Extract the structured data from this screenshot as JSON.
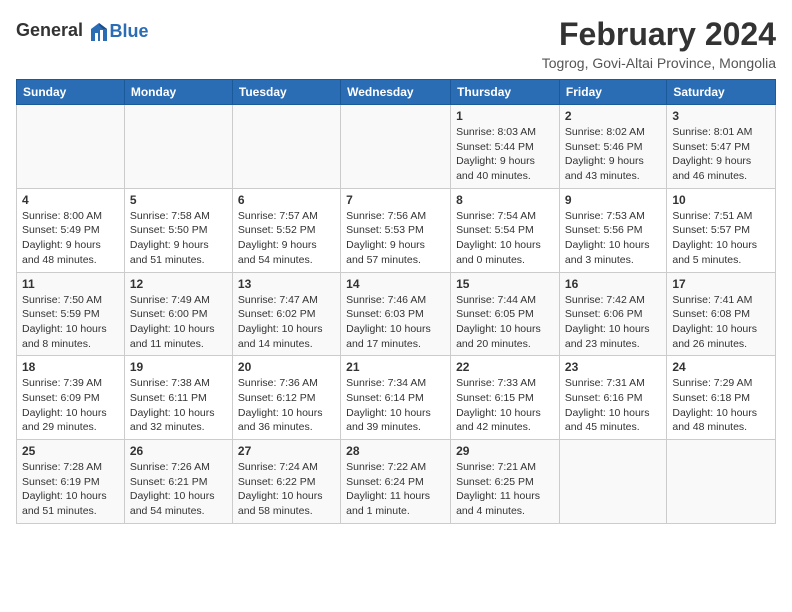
{
  "header": {
    "logo_general": "General",
    "logo_blue": "Blue",
    "title": "February 2024",
    "subtitle": "Togrog, Govi-Altai Province, Mongolia"
  },
  "weekdays": [
    "Sunday",
    "Monday",
    "Tuesday",
    "Wednesday",
    "Thursday",
    "Friday",
    "Saturday"
  ],
  "weeks": [
    [
      {
        "day": "",
        "sunrise": "",
        "sunset": "",
        "daylight": ""
      },
      {
        "day": "",
        "sunrise": "",
        "sunset": "",
        "daylight": ""
      },
      {
        "day": "",
        "sunrise": "",
        "sunset": "",
        "daylight": ""
      },
      {
        "day": "",
        "sunrise": "",
        "sunset": "",
        "daylight": ""
      },
      {
        "day": "1",
        "sunrise": "Sunrise: 8:03 AM",
        "sunset": "Sunset: 5:44 PM",
        "daylight": "Daylight: 9 hours and 40 minutes."
      },
      {
        "day": "2",
        "sunrise": "Sunrise: 8:02 AM",
        "sunset": "Sunset: 5:46 PM",
        "daylight": "Daylight: 9 hours and 43 minutes."
      },
      {
        "day": "3",
        "sunrise": "Sunrise: 8:01 AM",
        "sunset": "Sunset: 5:47 PM",
        "daylight": "Daylight: 9 hours and 46 minutes."
      }
    ],
    [
      {
        "day": "4",
        "sunrise": "Sunrise: 8:00 AM",
        "sunset": "Sunset: 5:49 PM",
        "daylight": "Daylight: 9 hours and 48 minutes."
      },
      {
        "day": "5",
        "sunrise": "Sunrise: 7:58 AM",
        "sunset": "Sunset: 5:50 PM",
        "daylight": "Daylight: 9 hours and 51 minutes."
      },
      {
        "day": "6",
        "sunrise": "Sunrise: 7:57 AM",
        "sunset": "Sunset: 5:52 PM",
        "daylight": "Daylight: 9 hours and 54 minutes."
      },
      {
        "day": "7",
        "sunrise": "Sunrise: 7:56 AM",
        "sunset": "Sunset: 5:53 PM",
        "daylight": "Daylight: 9 hours and 57 minutes."
      },
      {
        "day": "8",
        "sunrise": "Sunrise: 7:54 AM",
        "sunset": "Sunset: 5:54 PM",
        "daylight": "Daylight: 10 hours and 0 minutes."
      },
      {
        "day": "9",
        "sunrise": "Sunrise: 7:53 AM",
        "sunset": "Sunset: 5:56 PM",
        "daylight": "Daylight: 10 hours and 3 minutes."
      },
      {
        "day": "10",
        "sunrise": "Sunrise: 7:51 AM",
        "sunset": "Sunset: 5:57 PM",
        "daylight": "Daylight: 10 hours and 5 minutes."
      }
    ],
    [
      {
        "day": "11",
        "sunrise": "Sunrise: 7:50 AM",
        "sunset": "Sunset: 5:59 PM",
        "daylight": "Daylight: 10 hours and 8 minutes."
      },
      {
        "day": "12",
        "sunrise": "Sunrise: 7:49 AM",
        "sunset": "Sunset: 6:00 PM",
        "daylight": "Daylight: 10 hours and 11 minutes."
      },
      {
        "day": "13",
        "sunrise": "Sunrise: 7:47 AM",
        "sunset": "Sunset: 6:02 PM",
        "daylight": "Daylight: 10 hours and 14 minutes."
      },
      {
        "day": "14",
        "sunrise": "Sunrise: 7:46 AM",
        "sunset": "Sunset: 6:03 PM",
        "daylight": "Daylight: 10 hours and 17 minutes."
      },
      {
        "day": "15",
        "sunrise": "Sunrise: 7:44 AM",
        "sunset": "Sunset: 6:05 PM",
        "daylight": "Daylight: 10 hours and 20 minutes."
      },
      {
        "day": "16",
        "sunrise": "Sunrise: 7:42 AM",
        "sunset": "Sunset: 6:06 PM",
        "daylight": "Daylight: 10 hours and 23 minutes."
      },
      {
        "day": "17",
        "sunrise": "Sunrise: 7:41 AM",
        "sunset": "Sunset: 6:08 PM",
        "daylight": "Daylight: 10 hours and 26 minutes."
      }
    ],
    [
      {
        "day": "18",
        "sunrise": "Sunrise: 7:39 AM",
        "sunset": "Sunset: 6:09 PM",
        "daylight": "Daylight: 10 hours and 29 minutes."
      },
      {
        "day": "19",
        "sunrise": "Sunrise: 7:38 AM",
        "sunset": "Sunset: 6:11 PM",
        "daylight": "Daylight: 10 hours and 32 minutes."
      },
      {
        "day": "20",
        "sunrise": "Sunrise: 7:36 AM",
        "sunset": "Sunset: 6:12 PM",
        "daylight": "Daylight: 10 hours and 36 minutes."
      },
      {
        "day": "21",
        "sunrise": "Sunrise: 7:34 AM",
        "sunset": "Sunset: 6:14 PM",
        "daylight": "Daylight: 10 hours and 39 minutes."
      },
      {
        "day": "22",
        "sunrise": "Sunrise: 7:33 AM",
        "sunset": "Sunset: 6:15 PM",
        "daylight": "Daylight: 10 hours and 42 minutes."
      },
      {
        "day": "23",
        "sunrise": "Sunrise: 7:31 AM",
        "sunset": "Sunset: 6:16 PM",
        "daylight": "Daylight: 10 hours and 45 minutes."
      },
      {
        "day": "24",
        "sunrise": "Sunrise: 7:29 AM",
        "sunset": "Sunset: 6:18 PM",
        "daylight": "Daylight: 10 hours and 48 minutes."
      }
    ],
    [
      {
        "day": "25",
        "sunrise": "Sunrise: 7:28 AM",
        "sunset": "Sunset: 6:19 PM",
        "daylight": "Daylight: 10 hours and 51 minutes."
      },
      {
        "day": "26",
        "sunrise": "Sunrise: 7:26 AM",
        "sunset": "Sunset: 6:21 PM",
        "daylight": "Daylight: 10 hours and 54 minutes."
      },
      {
        "day": "27",
        "sunrise": "Sunrise: 7:24 AM",
        "sunset": "Sunset: 6:22 PM",
        "daylight": "Daylight: 10 hours and 58 minutes."
      },
      {
        "day": "28",
        "sunrise": "Sunrise: 7:22 AM",
        "sunset": "Sunset: 6:24 PM",
        "daylight": "Daylight: 11 hours and 1 minute."
      },
      {
        "day": "29",
        "sunrise": "Sunrise: 7:21 AM",
        "sunset": "Sunset: 6:25 PM",
        "daylight": "Daylight: 11 hours and 4 minutes."
      },
      {
        "day": "",
        "sunrise": "",
        "sunset": "",
        "daylight": ""
      },
      {
        "day": "",
        "sunrise": "",
        "sunset": "",
        "daylight": ""
      }
    ]
  ]
}
